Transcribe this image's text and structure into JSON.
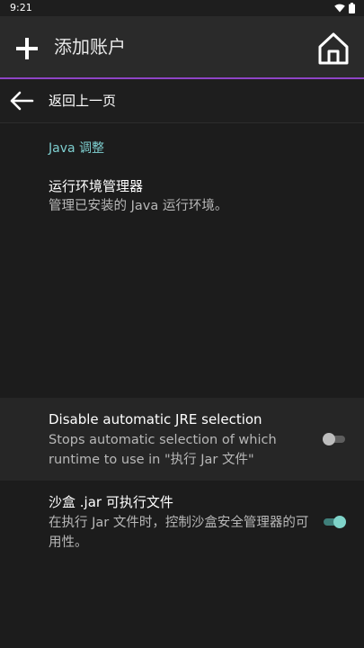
{
  "status_bar": {
    "time": "9:21"
  },
  "app_bar": {
    "title": "添加账户",
    "add_icon": "plus-icon",
    "home_icon": "home-icon",
    "accent_color": "#8e44c6"
  },
  "back_row": {
    "label": "返回上一页",
    "icon": "arrow-left-icon"
  },
  "section": {
    "title": "Java 调整",
    "accent_color": "#7ecfd0"
  },
  "preferences": [
    {
      "title": "运行环境管理器",
      "summary": "管理已安装的 Java 运行环境。"
    },
    {
      "title": "Disable automatic JRE selection",
      "summary": "Stops automatic selection of which runtime to use in \"执行 Jar 文件\"",
      "switch_on": false
    },
    {
      "title": "沙盒 .jar 可执行文件",
      "summary": "在执行 Jar 文件时，控制沙盒安全管理器的可用性。",
      "switch_on": true
    }
  ]
}
